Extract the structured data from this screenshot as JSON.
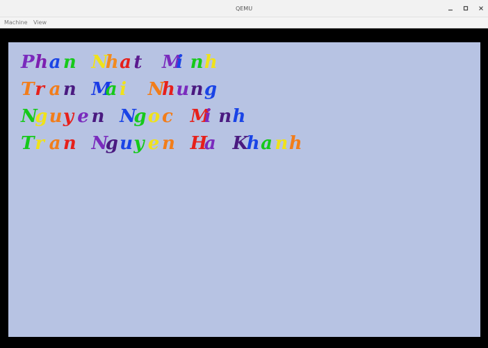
{
  "window": {
    "title": "QEMU",
    "controls": [
      "minimize",
      "maximize",
      "close"
    ]
  },
  "menubar": {
    "machine_label": "Machine",
    "view_label": "View"
  },
  "screen": {
    "background": "#b7c3e3",
    "lines": [
      {
        "text": "Phan Nhat Minh",
        "glyphs": [
          {
            "ch": "P",
            "color": "#7a2bbd"
          },
          {
            "ch": "h",
            "color": "#7d1fb0"
          },
          {
            "ch": "a",
            "color": "#1a44e6"
          },
          {
            "ch": "n",
            "color": "#16c91a"
          },
          {
            "ch": " ",
            "color": ""
          },
          {
            "ch": "N",
            "color": "#f0e21a"
          },
          {
            "ch": "h",
            "color": "#f28a1f"
          },
          {
            "ch": "a",
            "color": "#e6201b"
          },
          {
            "ch": "t",
            "color": "#5b1a8f"
          },
          {
            "ch": " ",
            "color": ""
          },
          {
            "ch": "M",
            "color": "#7a2bbd"
          },
          {
            "ch": "i",
            "color": "#1a44e6"
          },
          {
            "ch": "n",
            "color": "#16c91a"
          },
          {
            "ch": "h",
            "color": "#f0e21a"
          }
        ]
      },
      {
        "text": "Tran Mai Nhung",
        "glyphs": [
          {
            "ch": "T",
            "color": "#f27d1a"
          },
          {
            "ch": "r",
            "color": "#e6201b"
          },
          {
            "ch": "a",
            "color": "#f27d1a"
          },
          {
            "ch": "n",
            "color": "#4a1a80"
          },
          {
            "ch": " ",
            "color": ""
          },
          {
            "ch": "M",
            "color": "#1a3be6"
          },
          {
            "ch": "a",
            "color": "#16c91a"
          },
          {
            "ch": "i",
            "color": "#f0e21a"
          },
          {
            "ch": " ",
            "color": ""
          },
          {
            "ch": "N",
            "color": "#f27d1a"
          },
          {
            "ch": "h",
            "color": "#e6201b"
          },
          {
            "ch": "u",
            "color": "#7a2bbd"
          },
          {
            "ch": "n",
            "color": "#4a1a80"
          },
          {
            "ch": "g",
            "color": "#1a44e6"
          }
        ]
      },
      {
        "text": "Nguyen Ngoc Minh",
        "glyphs": [
          {
            "ch": "N",
            "color": "#16c91a"
          },
          {
            "ch": "g",
            "color": "#f0e21a"
          },
          {
            "ch": "u",
            "color": "#f27d1a"
          },
          {
            "ch": "y",
            "color": "#e6201b"
          },
          {
            "ch": "e",
            "color": "#7a2bbd"
          },
          {
            "ch": "n",
            "color": "#4a1a80"
          },
          {
            "ch": " ",
            "color": ""
          },
          {
            "ch": "N",
            "color": "#1a44e6"
          },
          {
            "ch": "g",
            "color": "#16c91a"
          },
          {
            "ch": "o",
            "color": "#f0e21a"
          },
          {
            "ch": "c",
            "color": "#f27d1a"
          },
          {
            "ch": " ",
            "color": ""
          },
          {
            "ch": "M",
            "color": "#e6201b"
          },
          {
            "ch": "i",
            "color": "#7a2bbd"
          },
          {
            "ch": "n",
            "color": "#4a1a80"
          },
          {
            "ch": "h",
            "color": "#1a44e6"
          }
        ]
      },
      {
        "text": "Tran Nguyen Ha Khanh",
        "glyphs": [
          {
            "ch": "T",
            "color": "#16c91a"
          },
          {
            "ch": "r",
            "color": "#f0e21a"
          },
          {
            "ch": "a",
            "color": "#f27d1a"
          },
          {
            "ch": "n",
            "color": "#e6201b"
          },
          {
            "ch": " ",
            "color": ""
          },
          {
            "ch": "N",
            "color": "#7a2bbd"
          },
          {
            "ch": "g",
            "color": "#4a1a80"
          },
          {
            "ch": "u",
            "color": "#1a44e6"
          },
          {
            "ch": "y",
            "color": "#16c91a"
          },
          {
            "ch": "e",
            "color": "#f0e21a"
          },
          {
            "ch": "n",
            "color": "#f27d1a"
          },
          {
            "ch": " ",
            "color": ""
          },
          {
            "ch": "H",
            "color": "#e6201b"
          },
          {
            "ch": "a",
            "color": "#7a2bbd"
          },
          {
            "ch": " ",
            "color": ""
          },
          {
            "ch": "K",
            "color": "#4a1a80"
          },
          {
            "ch": "h",
            "color": "#1a44e6"
          },
          {
            "ch": "a",
            "color": "#16c91a"
          },
          {
            "ch": "n",
            "color": "#f0e21a"
          },
          {
            "ch": "h",
            "color": "#f27d1a"
          }
        ]
      }
    ]
  }
}
